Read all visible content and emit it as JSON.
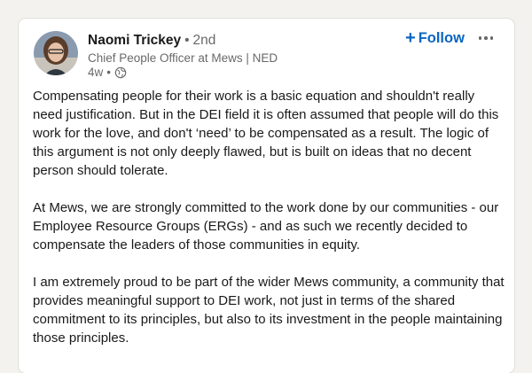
{
  "post": {
    "author": {
      "name": "Naomi Trickey",
      "degree": "2nd",
      "separator": "•",
      "headline": "Chief People Officer at Mews | NED",
      "time": "4w",
      "meta_separator": "•",
      "visibility_icon": "globe-icon"
    },
    "follow_label": "Follow",
    "follow_icon": "plus-icon",
    "more_icon": "ellipsis-icon",
    "paragraphs": [
      "Compensating people for their work is a basic equation and shouldn't really need justification. But in the DEI field it is often assumed that people will do this work for the love, and don't ‘need’ to be compensated as a result. The logic of this argument is not only deeply flawed, but is built on ideas that no decent person should tolerate.",
      "At Mews, we are strongly committed to the work done by our communities - our Employee Resource Groups (ERGs) - and as such we recently decided to compensate the leaders of those communities in equity.",
      "I am extremely proud to be part of the wider Mews community, a community that provides meaningful support to DEI work, not just in terms of the shared commitment to its principles, but also to its investment in the people maintaining those principles."
    ]
  },
  "colors": {
    "accent": "#0a66c2",
    "page_background": "#f4f2ee",
    "card_background": "#ffffff"
  }
}
